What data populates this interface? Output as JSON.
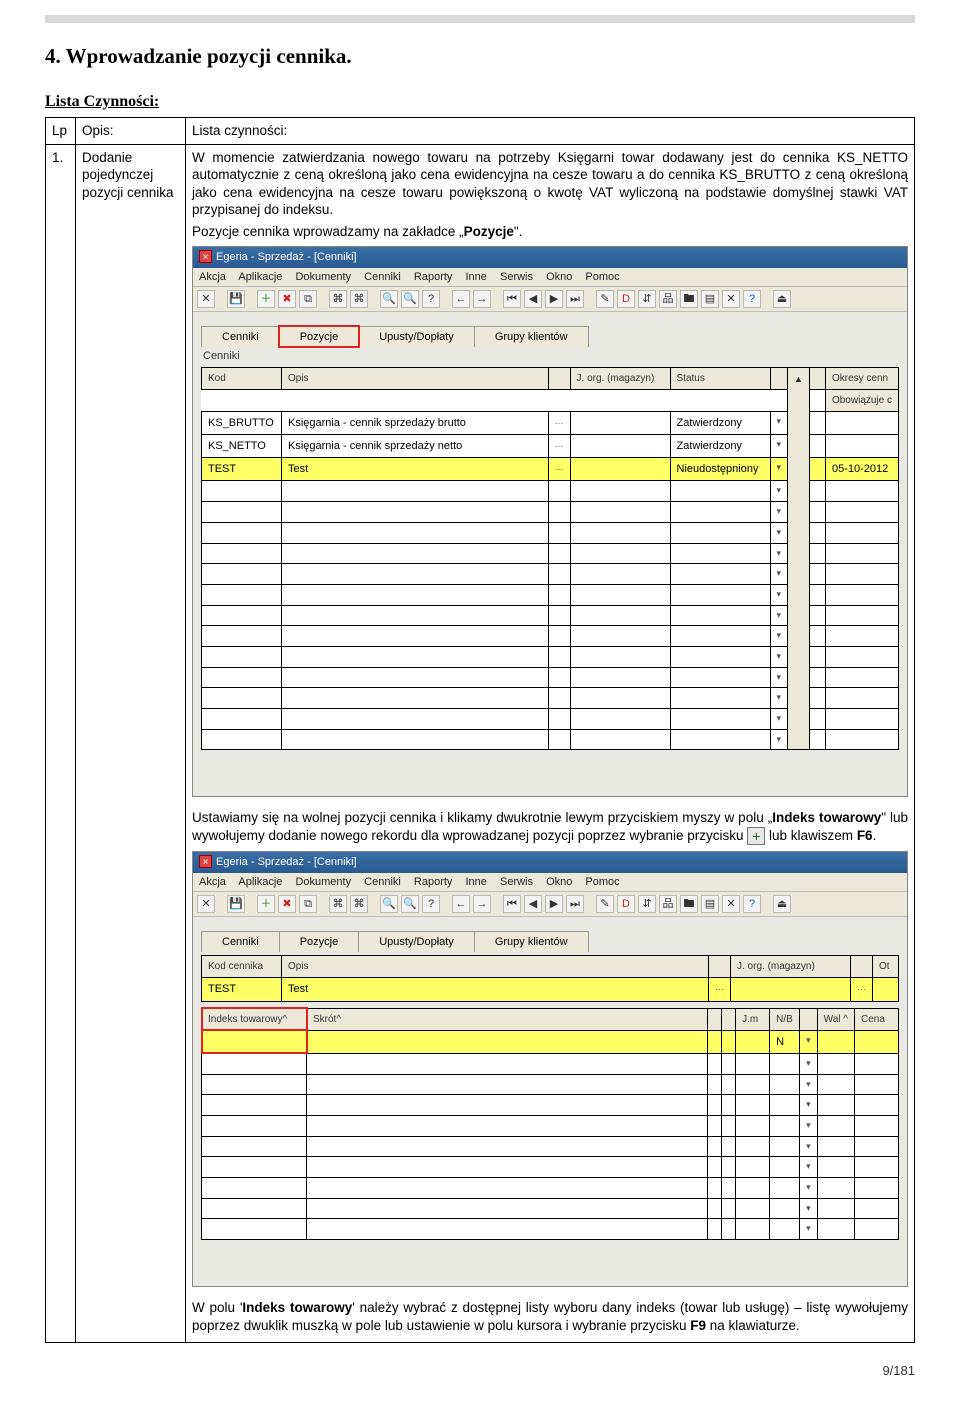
{
  "page_title": "4.  Wprowadzanie pozycji cennika.",
  "list_label": "Lista Czynności:",
  "outer_table_headers": {
    "lp": "Lp",
    "opis": "Opis:",
    "lista": "Lista czynności:"
  },
  "row": {
    "lp": "1.",
    "opis": "Dodanie pojedynczej pozycji cennika",
    "para1": "W momencie zatwierdzania nowego towaru na potrzeby Księgarni towar dodawany jest do cennika KS_NETTO automatycznie z ceną określoną jako cena ewidencyjna na cesze towaru a do cennika KS_BRUTTO z ceną określoną jako cena ewidencyjna na cesze towaru powiększoną o kwotę VAT wyliczoną na podstawie domyślnej stawki VAT przypisanej do indeksu.",
    "para2_prefix": "Pozycje cennika wprowadzamy na zakładce „",
    "para2_bold": "Pozycje",
    "para2_suffix": "\".",
    "para3_a": "Ustawiamy się na wolnej pozycji cennika i klikamy dwukrotnie lewym przyciskiem myszy w polu „",
    "para3_bold1": "Indeks towarowy",
    "para3_b": "\" lub wywołujemy dodanie nowego rekordu dla wprowadzanej pozycji poprzez wybranie przycisku ",
    "para3_c": " lub klawiszem ",
    "para3_bold2": "F6",
    "para3_d": ".",
    "para4_a": "W polu '",
    "para4_bold1": "Indeks towarowy",
    "para4_b": "' należy wybrać z dostępnej listy wyboru dany indeks (towar lub usługę) – listę wywołujemy poprzez dwuklik muszką w pole lub ustawienie w polu kursora i wybranie przycisku ",
    "para4_bold2": "F9",
    "para4_c": " na klawiaturze."
  },
  "app": {
    "title": "Egeria - Sprzedaż - [Cenniki]",
    "menus": [
      "Akcja",
      "Aplikacje",
      "Dokumenty",
      "Cenniki",
      "Raporty",
      "Inne",
      "Serwis",
      "Okno",
      "Pomoc"
    ],
    "tabs": [
      "Cenniki",
      "Pozycje",
      "Upusty/Dopłaty",
      "Grupy klientów"
    ],
    "cenniki_label": "Cenniki",
    "grid1": {
      "headers": [
        "Kod",
        "Opis",
        "",
        "J. org. (magazyn)",
        "Status",
        "",
        "Okresy cenn",
        "Obowiązuje c"
      ],
      "rows": [
        {
          "kod": "KS_BRUTTO",
          "opis": "Księgarnia - cennik sprzedaży brutto",
          "jorg": "",
          "status": "Zatwierdzony",
          "data": "",
          "yellow": false
        },
        {
          "kod": "KS_NETTO",
          "opis": "Księgarnia - cennik sprzedaży netto",
          "jorg": "",
          "status": "Zatwierdzony",
          "data": "",
          "yellow": false
        },
        {
          "kod": "TEST",
          "opis": "Test",
          "jorg": "",
          "status": "Nieudostępniony",
          "data": "05-10-2012",
          "yellow": true
        }
      ]
    },
    "grid2_hdr1": {
      "headers": [
        "Kod cennika",
        "Opis",
        "",
        "J. org. (magazyn)",
        "",
        "Ot"
      ],
      "row": {
        "kod": "TEST",
        "opis": "Test",
        "jorg": "",
        "yellow": true
      }
    },
    "grid2_hdr2": {
      "headers": [
        "Indeks towarowy^",
        "Skrót^",
        "",
        "",
        "J.m",
        "N/B",
        "",
        "Wal ^",
        "Cena"
      ]
    }
  },
  "add_icon": "+",
  "page_footer": "9/181"
}
